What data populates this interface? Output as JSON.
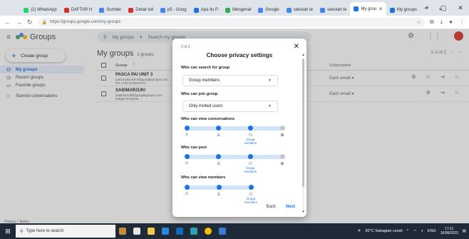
{
  "browser": {
    "tabs": [
      {
        "label": "(2) WhatsApp",
        "color": "#25d366"
      },
      {
        "label": "DAFTAR H",
        "color": "#d93025"
      },
      {
        "label": "Sumber",
        "color": "#4285f4"
      },
      {
        "label": "Detail vid",
        "color": "#d93025"
      },
      {
        "label": "p5 - Goog",
        "color": "#4285f4"
      },
      {
        "label": "Apa itu P",
        "color": "#1a73e8"
      },
      {
        "label": "Mengenal",
        "color": "#34a853"
      },
      {
        "label": "Google",
        "color": "#4285f4"
      },
      {
        "label": "sekolah te",
        "color": "#4285f4"
      },
      {
        "label": "sekolah te",
        "color": "#4285f4"
      },
      {
        "label": "My grou",
        "color": "#1a73e8",
        "active": true
      },
      {
        "label": "My groups",
        "color": "#1a73e8"
      }
    ],
    "new_tab": "+",
    "url": "https://groups.google.com/my-groups"
  },
  "app": {
    "name": "Groups",
    "search_scope": "My groups",
    "search_placeholder": "Search my groups"
  },
  "sidebar": {
    "create": "Create group",
    "items": [
      {
        "label": "My groups",
        "icon": "groups-icon",
        "active": true
      },
      {
        "label": "Recent groups",
        "icon": "clock-icon"
      },
      {
        "label": "Favorite groups",
        "icon": "folder-icon"
      },
      {
        "label": "Starred conversations",
        "icon": "star-icon"
      }
    ],
    "privacy_terms": "Privacy • Terms"
  },
  "main": {
    "title": "My groups",
    "count": "2 groups",
    "pager": "1–2 of 2",
    "col_group": "Group",
    "col_subscription": "Subscription",
    "rows": [
      {
        "name": "PASCA PAI UNIT 3",
        "email": "pasca-pai-unit-3@googlegroups.com",
        "desc": "IIIT LATA RUDIANTO",
        "subscription": "Each email"
      },
      {
        "name": "SAIDMARZUKI",
        "email": "saidmarzuki@googlegroups.com",
        "desc": "belajar bersama",
        "subscription": "Each email"
      }
    ]
  },
  "dialog": {
    "step": "2 of 3",
    "title": "Choose privacy settings",
    "search_label": "Who can search for group",
    "search_value": "Group members",
    "join_label": "Who can join group",
    "join_value": "Only invited users",
    "view_conv_label": "Who can view conversations",
    "post_label": "Who can post",
    "view_members_label": "Who can view members",
    "selected_caption": "Group members",
    "back": "Back",
    "next": "Next",
    "sliders": {
      "view_conversations": {
        "selected_index": 2,
        "levels": 4
      },
      "post": {
        "selected_index": 2,
        "levels": 4
      },
      "view_members": {
        "selected_index": 2,
        "levels": 3
      }
    }
  },
  "taskbar": {
    "search_placeholder": "Type here to search",
    "weather": "30°C Sebagian cerah",
    "lang": "ENG",
    "time": "17:11",
    "date": "16/06/2023"
  }
}
